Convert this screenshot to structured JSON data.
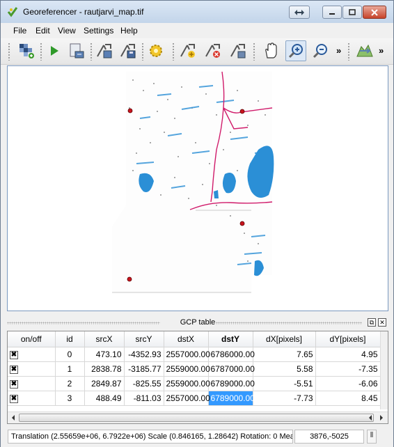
{
  "window": {
    "title": "Georeferencer - rautjarvi_map.tif"
  },
  "menu": [
    {
      "label": "File"
    },
    {
      "label": "Edit"
    },
    {
      "label": "View"
    },
    {
      "label": "Settings"
    },
    {
      "label": "Help"
    }
  ],
  "toolbar": {
    "icons": [
      "open-raster-icon",
      "start-georeferencing-icon",
      "generate-script-icon",
      "load-gcp-icon",
      "save-gcp-icon",
      "transformation-settings-icon",
      "add-point-icon",
      "delete-point-icon",
      "move-point-icon",
      "pan-icon",
      "zoom-in-icon",
      "zoom-out-icon",
      "link-georeferencer-icon"
    ],
    "overflow_label": "»"
  },
  "gcp_panel": {
    "title": "GCP table",
    "float_label": "⧉",
    "close_label": "✕"
  },
  "gcp_table": {
    "columns": [
      "on/off",
      "id",
      "srcX",
      "srcY",
      "dstX",
      "dstY",
      "dX[pixels]",
      "dY[pixels]"
    ],
    "sorted_column": "dstY",
    "rows": [
      {
        "on": "✖",
        "id": "0",
        "srcX": "473.10",
        "srcY": "-4352.93",
        "dstX": "2557000.00",
        "dstY": "6786000.00",
        "dX": "7.65",
        "dY": "4.95"
      },
      {
        "on": "✖",
        "id": "1",
        "srcX": "2838.78",
        "srcY": "-3185.77",
        "dstX": "2559000.00",
        "dstY": "6787000.00",
        "dX": "5.58",
        "dY": "-7.35"
      },
      {
        "on": "✖",
        "id": "2",
        "srcX": "2849.87",
        "srcY": "-825.55",
        "dstX": "2559000.00",
        "dstY": "6789000.00",
        "dX": "-5.51",
        "dY": "-6.06"
      },
      {
        "on": "✖",
        "id": "3",
        "srcX": "488.49",
        "srcY": "-811.03",
        "dstX": "2557000.00",
        "dstY": "6789000.00",
        "dX": "-7.73",
        "dY": "8.45"
      }
    ],
    "selected_cell": "3.dstY"
  },
  "statusbar": {
    "message": "Translation (2.55659e+06, 6.7922e+06) Scale (0.846165, 1.28642) Rotation: 0 Mea",
    "coordinates": "3876,-5025"
  }
}
